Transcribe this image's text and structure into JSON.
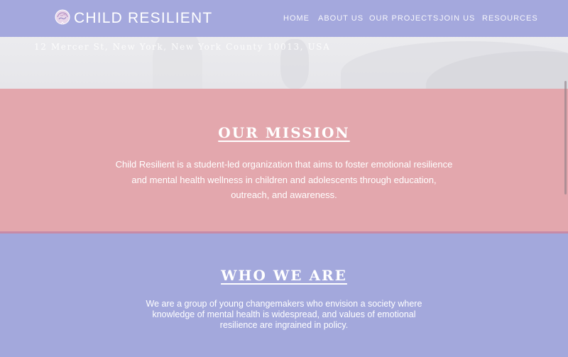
{
  "brand": {
    "name": "CHILD RESILIENT"
  },
  "nav": {
    "items": [
      "HOME",
      "ABOUT US",
      "OUR PROJECTS",
      "JOIN US",
      "RESOURCES"
    ]
  },
  "hero": {
    "address": "12 Mercer St, New York, New York County 10013, USA"
  },
  "mission": {
    "title": "OUR MISSION",
    "lines": [
      "Child Resilient is a student-led organization that aims to foster emotional resilience",
      "and mental health wellness in children and adolescents through education,",
      "outreach, and awareness."
    ]
  },
  "who": {
    "title": "WHO WE ARE",
    "lines": [
      "We are a group of young changemakers who envision a society where",
      "knowledge of mental health is widespread, and values of emotional",
      "resilience are ingrained in policy."
    ]
  },
  "colors": {
    "nav_bg": "#a4a8dd",
    "mission_bg": "#e3a7ad",
    "who_bg": "#a3a8dc",
    "divider": "#c78aa6"
  },
  "icons": {
    "logo": "brain-head-icon"
  }
}
